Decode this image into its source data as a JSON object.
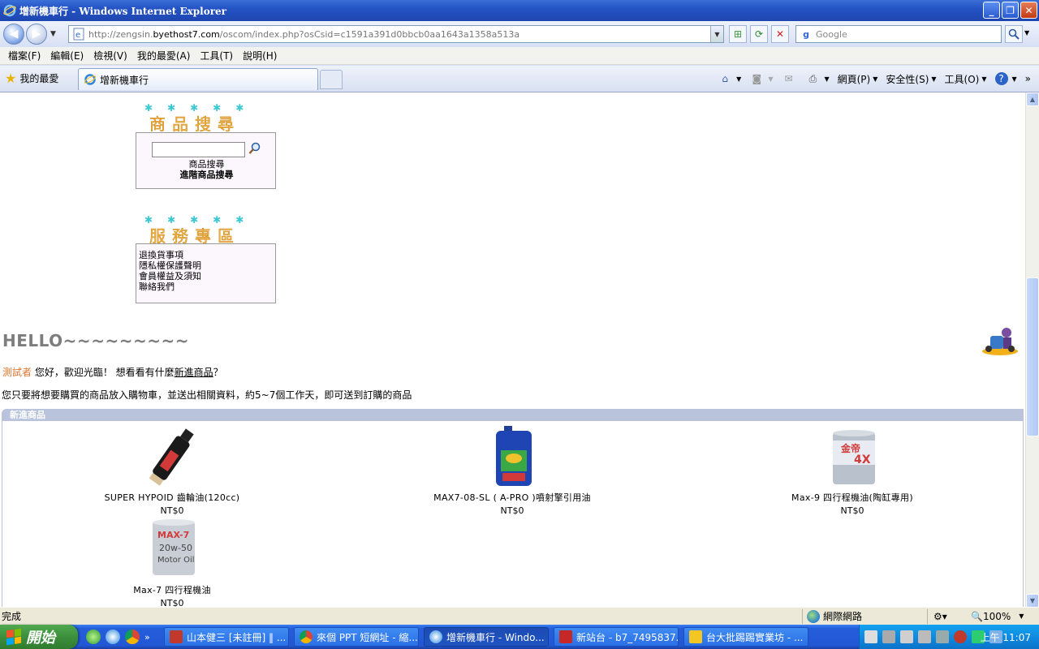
{
  "window": {
    "title": "增新機車行 - Windows Internet Explorer",
    "minimize": "_",
    "restore": "❐",
    "close": "✕"
  },
  "address": {
    "url_prefix": "http://zengsin.",
    "url_host": "byethost7.com",
    "url_rest": "/oscom/index.php?osCsid=c1591a391d0bbcb0aa1643a1358a513a",
    "search_placeholder": "Google"
  },
  "menu": [
    "檔案(F)",
    "編輯(E)",
    "檢視(V)",
    "我的最愛(A)",
    "工具(T)",
    "說明(H)"
  ],
  "tabs": {
    "favorites_label": "我的最愛",
    "active_tab": "增新機車行"
  },
  "commandbar": {
    "page": "網頁(P)",
    "safety": "安全性(S)",
    "tools": "工具(O)"
  },
  "search_box": {
    "header": "商品搜尋",
    "link_search": "商品搜尋",
    "link_advanced": "進階商品搜尋"
  },
  "service_box": {
    "header": "服務專區",
    "links": [
      "退換貨事項",
      "隱私權保護聲明",
      "會員權益及須知",
      "聯絡我們"
    ]
  },
  "main": {
    "hello": "HELLO~~~~~~~~~",
    "user_name": "測試者",
    "welcome_text": " 您好，歡迎光臨！ 想看看有什麼",
    "new_products_link": "新進商品",
    "welcome_end": "？",
    "note": "您只要將想要購買的商品放入購物車，並送出相關資料，約5~7個工作天，即可送到訂購的商品",
    "new_products_header": "新進商品"
  },
  "products": [
    {
      "name": "SUPER HYPOID 齒輪油(120cc)",
      "price": "NT$0"
    },
    {
      "name": "MAX7-08-SL ( A-PRO )噴射擎引用油",
      "price": "NT$0"
    },
    {
      "name": "Max-9 四行程機油(陶缸專用)",
      "price": "NT$0"
    },
    {
      "name": "Max-7 四行程機油",
      "price": "NT$0"
    }
  ],
  "product_labels": {
    "p3_brand": "金帝",
    "p3_num": "4X",
    "p4_brand": "MAX-7",
    "p4_grade": "20w-50",
    "p4_type": "Motor Oil"
  },
  "status": {
    "text": "完成",
    "zone": "網際網路",
    "zoom": "100%"
  },
  "taskbar": {
    "start": "開始",
    "items": [
      "山本健三 [未註冊] ‖ ...",
      "來個 PPT 短網址 - 縮...",
      "增新機車行 - Windo...",
      "新站台 - b7_7495837...",
      "台大批踢踢實業坊 - ..."
    ],
    "clock": "上午 11:07"
  },
  "colors": {
    "accent": "#2453c4",
    "user_name": "#e0782e",
    "section_bar": "#b9c4dc"
  }
}
